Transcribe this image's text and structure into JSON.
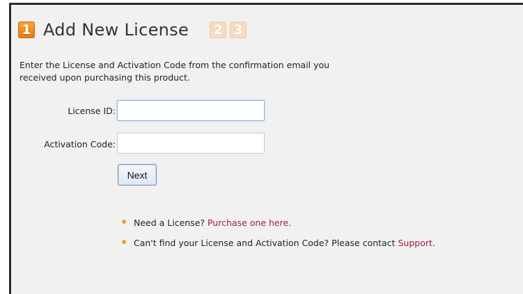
{
  "header": {
    "step_active": "1",
    "title": "Add New License",
    "step_2": "2",
    "step_3": "3"
  },
  "intro": {
    "line1": "Enter the License and Activation Code from the confirmation email you",
    "line2": "received upon purchasing this product."
  },
  "form": {
    "license_id_label": "License ID:",
    "license_id_value": "",
    "activation_code_label": "Activation Code:",
    "activation_code_value": "",
    "next_label": "Next"
  },
  "help": {
    "need_license_text": "Need a License?",
    "purchase_link": "Purchase one here.",
    "cant_find_text": "Can't find your License and Activation Code? Please contact",
    "support_link": "Support",
    "support_suffix": "."
  },
  "colors": {
    "step_active": "#f08a1e",
    "step_inactive": "#f6dcc0",
    "link": "#a31f38",
    "bullet": "#f39b2c",
    "panel_bg": "#f1f1f1"
  }
}
